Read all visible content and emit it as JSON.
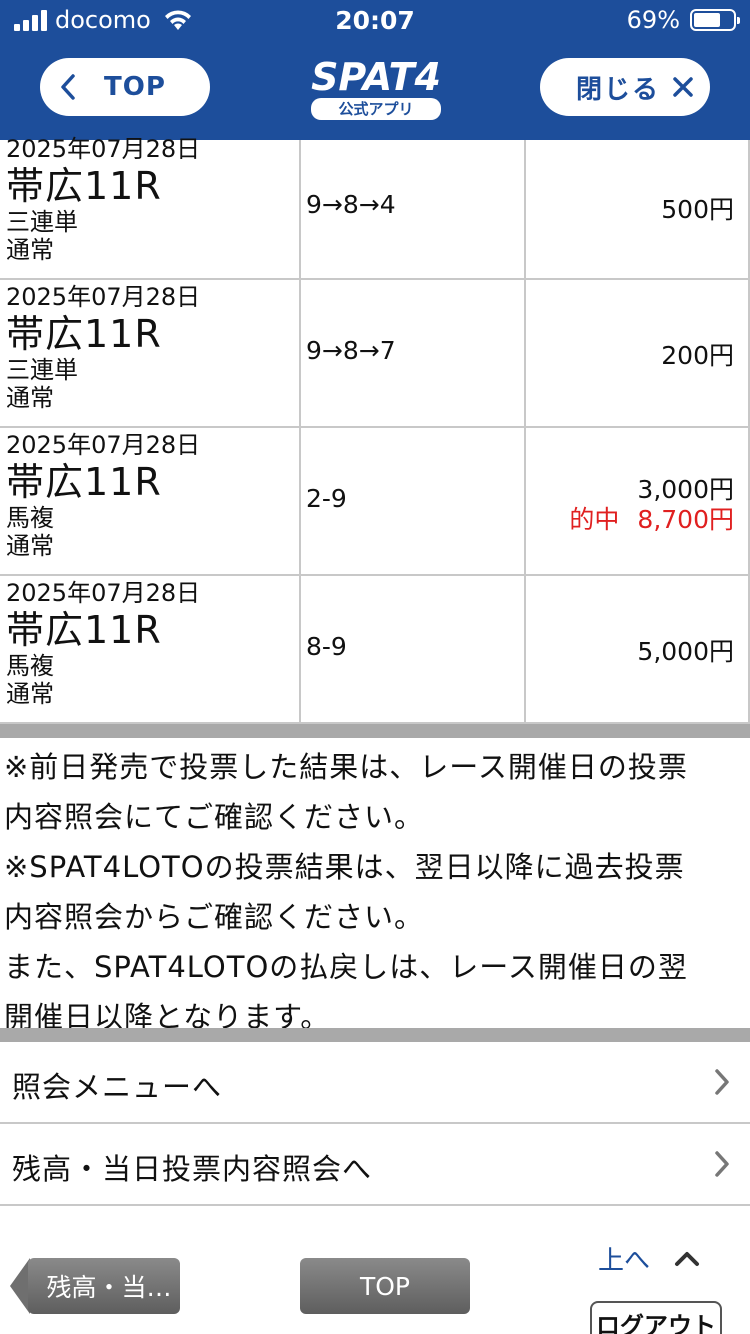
{
  "status_bar": {
    "carrier": "docomo",
    "time": "20:07",
    "battery": "69%",
    "battery_level": 0.69
  },
  "header": {
    "top_label": "TOP",
    "logo_main": "SPAT4",
    "logo_sub": "公式アプリ",
    "close_label": "閉じる"
  },
  "rows": [
    {
      "date": "2025年07月28日",
      "race": "帯広11R",
      "type": "三連単",
      "mode": "通常",
      "combo": "9→8→4",
      "amount": "500円",
      "hit": false
    },
    {
      "date": "2025年07月28日",
      "race": "帯広11R",
      "type": "三連単",
      "mode": "通常",
      "combo": "9→8→7",
      "amount": "200円",
      "hit": false
    },
    {
      "date": "2025年07月28日",
      "race": "帯広11R",
      "type": "馬複",
      "mode": "通常",
      "combo": "2-9",
      "amount": "3,000円",
      "hit": true,
      "hit_label": "的中",
      "hit_amount": "8,700円"
    },
    {
      "date": "2025年07月28日",
      "race": "帯広11R",
      "type": "馬複",
      "mode": "通常",
      "combo": "8-9",
      "amount": "5,000円",
      "hit": false
    }
  ],
  "notes": {
    "line1": "※前日発売で投票した結果は、レース開催日の投票",
    "line2": "内容照会にてご確認ください。",
    "line3": "※SPAT4LOTOの投票結果は、翌日以降に過去投票",
    "line4": "内容照会からご確認ください。",
    "line5": "また、SPAT4LOTOの払戻しは、レース開催日の翌",
    "line6": "開催日以降となります。"
  },
  "menu": [
    {
      "label": "照会メニューへ"
    },
    {
      "label": "残高・当日投票内容照会へ"
    }
  ],
  "footer": {
    "back_label": "残高・当…",
    "top_label": "TOP",
    "up_label": "上へ",
    "logout_label": "ログアウト"
  },
  "colors": {
    "header_blue": "#1d4e9b",
    "hit_red": "#e02020",
    "divider_grey": "#a9a9a9"
  }
}
